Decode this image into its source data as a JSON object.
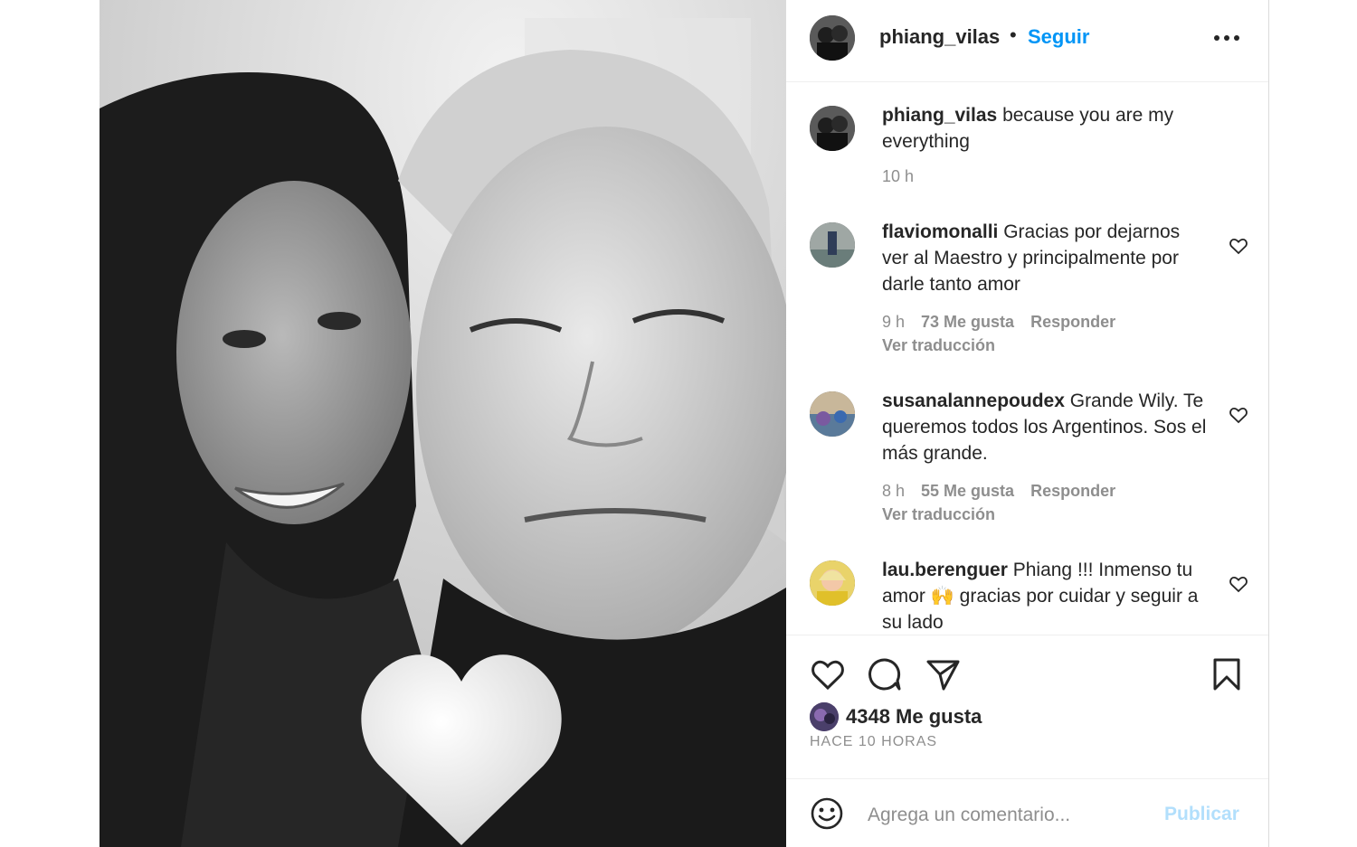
{
  "post": {
    "username": "phiang_vilas",
    "separator": "•",
    "follow_label": "Seguir",
    "more_icon": "more-options-icon"
  },
  "caption": {
    "username": "phiang_vilas",
    "text": "because you are my everything",
    "time": "10 h"
  },
  "comments": [
    {
      "username": "flaviomonalli",
      "text": "Gracias por dejarnos ver al Maestro y principalmente por darle tanto amor",
      "time": "9 h",
      "likes": "73 Me gusta",
      "reply": "Responder",
      "translate": "Ver traducción"
    },
    {
      "username": "susanalannepoudex",
      "text": "Grande Wily. Te queremos todos los Argentinos. Sos el más grande.",
      "time": "8 h",
      "likes": "55 Me gusta",
      "reply": "Responder",
      "translate": "Ver traducción"
    },
    {
      "username": "lau.berenguer",
      "text": "Phiang !!! Inmenso tu amor 🙌 gracias por cuidar y seguir a su lado"
    }
  ],
  "actions": {
    "like_icon": "heart-icon",
    "comment_icon": "comment-bubble-icon",
    "share_icon": "send-icon",
    "save_icon": "bookmark-icon",
    "likes_label": "4348 Me gusta",
    "posted_ago": "HACE 10 HORAS"
  },
  "add_comment": {
    "placeholder": "Agrega un comentario...",
    "publish_label": "Publicar"
  },
  "colors": {
    "link_blue": "#0095f6",
    "publish_disabled": "#b2dffc",
    "secondary_text": "#8e8e8e"
  }
}
